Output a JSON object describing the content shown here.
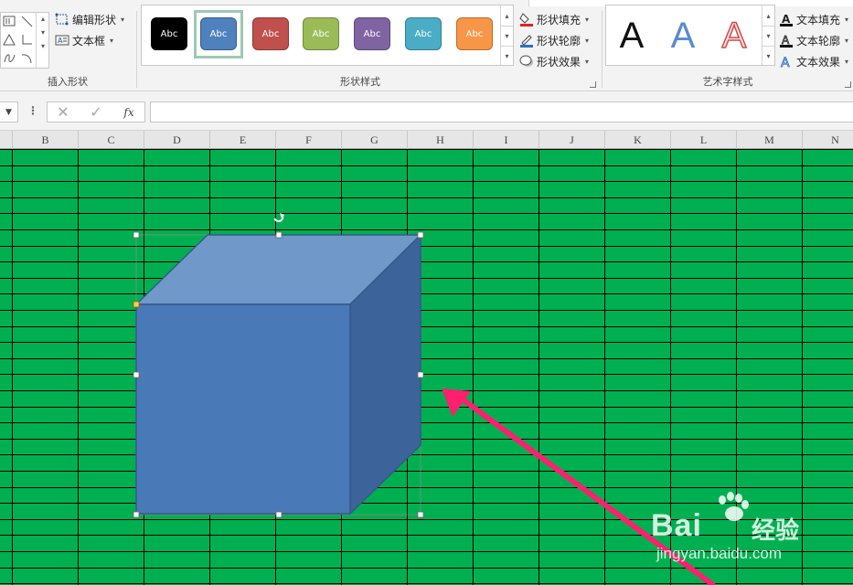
{
  "ribbon": {
    "groups": {
      "insert_shapes": {
        "label": "插入形状",
        "edit_shape": "编辑形状",
        "text_box": "文本框"
      },
      "shape_styles": {
        "label": "形状样式",
        "swatches": [
          {
            "label": "Abc",
            "fill": "#000000",
            "border": "#000000"
          },
          {
            "label": "Abc",
            "fill": "#4f81bd",
            "border": "#385d8a"
          },
          {
            "label": "Abc",
            "fill": "#c0504d",
            "border": "#8c3836"
          },
          {
            "label": "Abc",
            "fill": "#9bbb59",
            "border": "#71893f"
          },
          {
            "label": "Abc",
            "fill": "#8064a2",
            "border": "#5c4776"
          },
          {
            "label": "Abc",
            "fill": "#4bacc6",
            "border": "#357d91"
          },
          {
            "label": "Abc",
            "fill": "#f79646",
            "border": "#b66d31"
          }
        ],
        "selected_index": 1,
        "shape_fill": "形状填充",
        "shape_outline": "形状轮廓",
        "shape_effects": "形状效果"
      },
      "wordart_styles": {
        "label": "艺术字样式",
        "samples": [
          "A",
          "A",
          "A"
        ],
        "text_fill": "文本填充",
        "text_outline": "文本轮廓",
        "text_effects": "文本效果"
      }
    }
  },
  "formula_bar": {
    "cancel_icon": "✕",
    "enter_icon": "✓",
    "function_label": "fx",
    "value": ""
  },
  "sheet": {
    "columns": [
      "B",
      "C",
      "D",
      "E",
      "F",
      "G",
      "H",
      "I",
      "J",
      "K",
      "L",
      "M",
      "N"
    ],
    "fill_color": "#00b050",
    "gridline_color": "#000000"
  },
  "shape": {
    "type": "cube",
    "front_color": "#4a79b8",
    "top_color": "#7098c8",
    "side_color": "#3c649a",
    "outline_color": "#35598a",
    "selected": true
  },
  "annotation": {
    "type": "arrow",
    "color": "#ff1f6e"
  },
  "watermark": {
    "brand": "Bai",
    "brand_cn": "经验",
    "url": "jingyan.baidu.com"
  }
}
